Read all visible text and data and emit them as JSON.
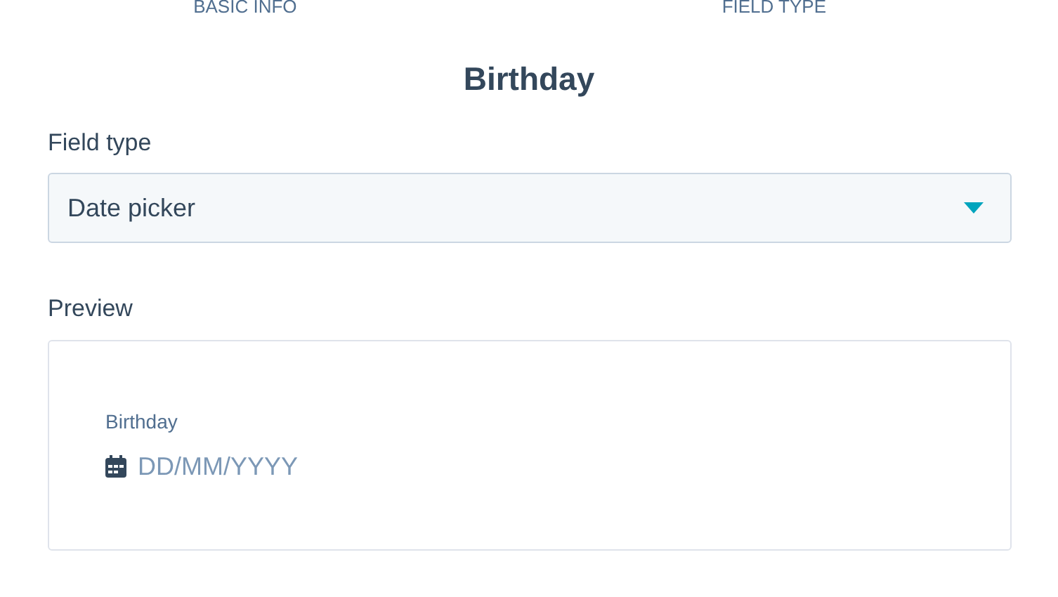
{
  "steps": [
    {
      "label": "BASIC INFO"
    },
    {
      "label": "FIELD TYPE"
    }
  ],
  "title": "Birthday",
  "field_type": {
    "label": "Field type",
    "value": "Date picker"
  },
  "preview": {
    "label": "Preview",
    "field_label": "Birthday",
    "placeholder": "DD/MM/YYYY"
  }
}
